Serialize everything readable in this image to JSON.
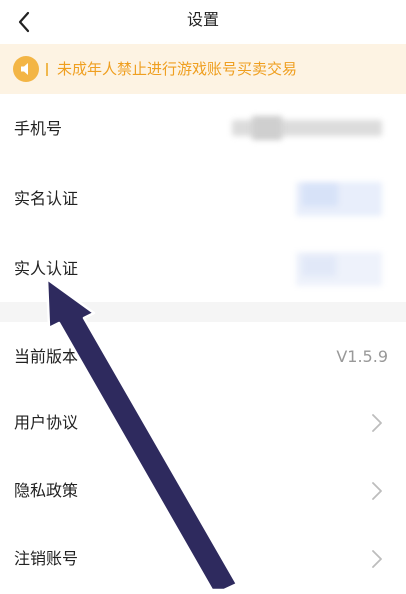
{
  "header": {
    "title": "设置",
    "back_icon": "chevron-left-icon"
  },
  "notice": {
    "icon": "speaker-icon",
    "text": "未成年人禁止进行游戏账号买卖交易",
    "color": "#ef9f20",
    "background": "#fdf3e3"
  },
  "account_section": {
    "rows": [
      {
        "label": "手机号"
      },
      {
        "label": "实名认证"
      },
      {
        "label": "实人认证"
      }
    ]
  },
  "about_section": {
    "version": {
      "label": "当前版本",
      "value": "V1.5.9"
    },
    "rows": [
      {
        "label": "用户协议",
        "icon": "chevron-right-icon"
      },
      {
        "label": "隐私政策",
        "icon": "chevron-right-icon"
      },
      {
        "label": "注销账号",
        "icon": "chevron-right-icon"
      }
    ]
  },
  "annotation": {
    "icon": "pointer-arrow-icon",
    "color": "#2e2a5e"
  }
}
